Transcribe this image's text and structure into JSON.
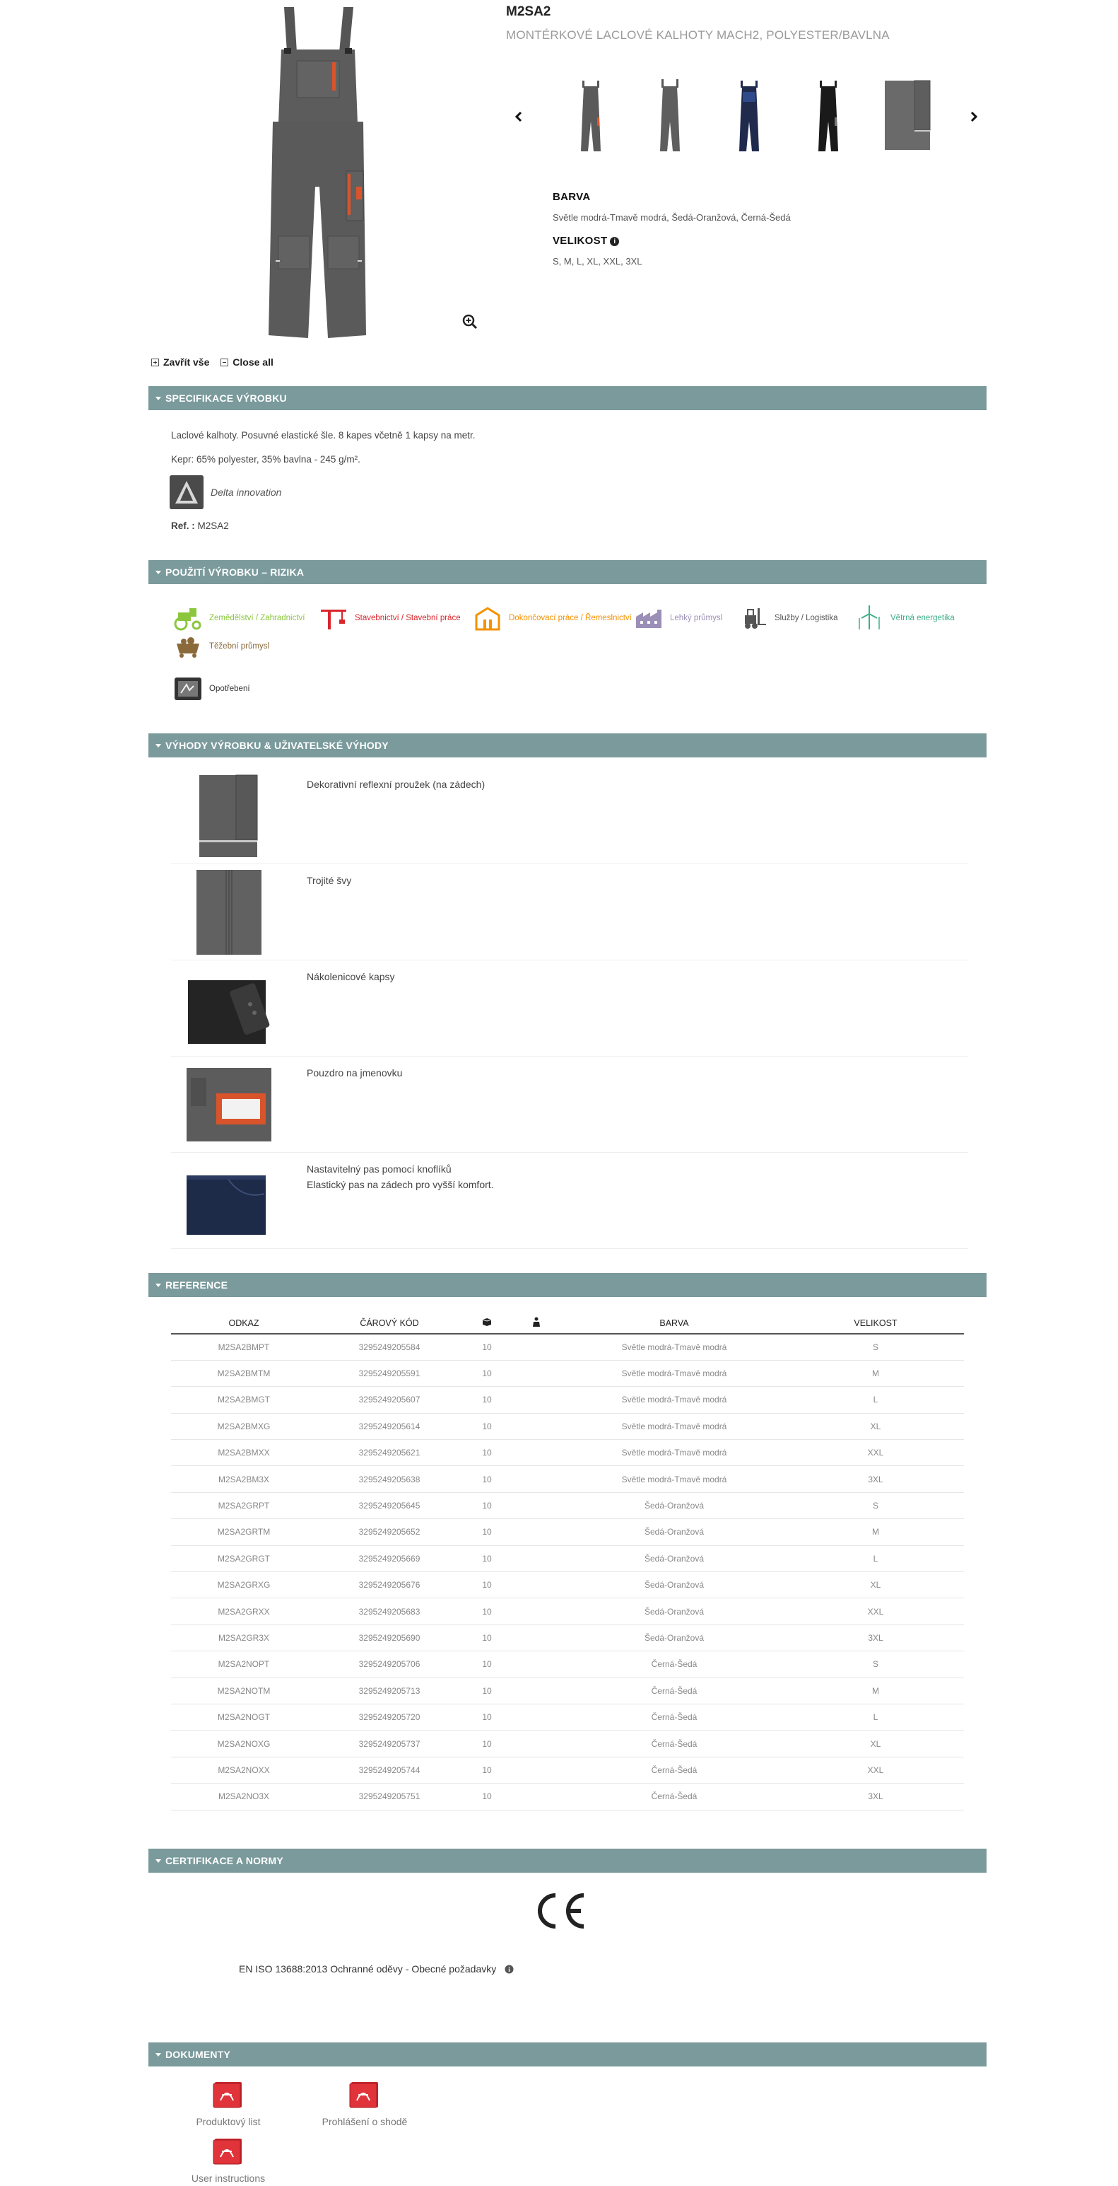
{
  "product": {
    "code": "M2SA2",
    "subtitle": "MONTÉRKOVÉ LACLOVÉ KALHOTY MACH2, POLYESTER/BAVLNA"
  },
  "attributes": {
    "color_heading": "BARVA",
    "color_value": "Světle modrá-Tmavě modrá, Šedá-Oranžová, Černá-Šedá",
    "size_heading": "VELIKOST",
    "size_value": "S, M, L, XL, XXL, 3XL"
  },
  "collapse": {
    "close_all_cz": "Zavřít vše",
    "close_all_en": "Close all"
  },
  "spec": {
    "title": "SPECIFIKACE VÝROBKU",
    "desc": "Laclové kalhoty. Posuvné elastické šle. 8 kapes včetně 1 kapsy na metr.",
    "material": "Kepr: 65% polyester, 35% bavlna - 245 g/m².",
    "innovation": "Delta innovation",
    "ref_label": "Ref. :",
    "ref_value": "M2SA2"
  },
  "usage": {
    "title": "POUŽITÍ VÝROBKU – RIZIKA",
    "items": [
      {
        "label": "Zemědělství / Zahradnictví",
        "color": "#8cc63f"
      },
      {
        "label": "Stavebnictví / Stavební práce",
        "color": "#d9262c"
      },
      {
        "label": "Dokončovací práce / Řemeslnictví",
        "color": "#f39200"
      },
      {
        "label": "Lehký průmysl",
        "color": "#9b8fb7"
      },
      {
        "label": "Služby / Logistika",
        "color": "#555555"
      },
      {
        "label": "Větrná energetika",
        "color": "#3fae8a"
      },
      {
        "label": "Těžební průmysl",
        "color": "#8a6a3a"
      },
      {
        "label": "Opotřebení",
        "color": "#333333"
      }
    ]
  },
  "benefits": {
    "title": "VÝHODY VÝROBKU & UŽIVATELSKÉ VÝHODY",
    "items": [
      {
        "line1": "Dekorativní reflexní proužek (na zádech)",
        "line2": ""
      },
      {
        "line1": "Trojité švy",
        "line2": ""
      },
      {
        "line1": "Nákolenicové kapsy",
        "line2": ""
      },
      {
        "line1": "Pouzdro na jmenovku",
        "line2": ""
      },
      {
        "line1": "Nastavitelný pas pomocí knoflíků",
        "line2": "Elastický pas na zádech pro vyšší komfort."
      }
    ]
  },
  "reference": {
    "title": "REFERENCE",
    "headers": {
      "odkaz": "ODKAZ",
      "kod": "ČÁROVÝ KÓD",
      "barva": "BARVA",
      "velikost": "VELIKOST"
    },
    "rows": [
      [
        "M2SA2BMPT",
        "3295249205584",
        "10",
        "Světle modrá-Tmavě modrá",
        "S"
      ],
      [
        "M2SA2BMTM",
        "3295249205591",
        "10",
        "Světle modrá-Tmavě modrá",
        "M"
      ],
      [
        "M2SA2BMGT",
        "3295249205607",
        "10",
        "Světle modrá-Tmavě modrá",
        "L"
      ],
      [
        "M2SA2BMXG",
        "3295249205614",
        "10",
        "Světle modrá-Tmavě modrá",
        "XL"
      ],
      [
        "M2SA2BMXX",
        "3295249205621",
        "10",
        "Světle modrá-Tmavě modrá",
        "XXL"
      ],
      [
        "M2SA2BM3X",
        "3295249205638",
        "10",
        "Světle modrá-Tmavě modrá",
        "3XL"
      ],
      [
        "M2SA2GRPT",
        "3295249205645",
        "10",
        "Šedá-Oranžová",
        "S"
      ],
      [
        "M2SA2GRTM",
        "3295249205652",
        "10",
        "Šedá-Oranžová",
        "M"
      ],
      [
        "M2SA2GRGT",
        "3295249205669",
        "10",
        "Šedá-Oranžová",
        "L"
      ],
      [
        "M2SA2GRXG",
        "3295249205676",
        "10",
        "Šedá-Oranžová",
        "XL"
      ],
      [
        "M2SA2GRXX",
        "3295249205683",
        "10",
        "Šedá-Oranžová",
        "XXL"
      ],
      [
        "M2SA2GR3X",
        "3295249205690",
        "10",
        "Šedá-Oranžová",
        "3XL"
      ],
      [
        "M2SA2NOPT",
        "3295249205706",
        "10",
        "Černá-Šedá",
        "S"
      ],
      [
        "M2SA2NOTM",
        "3295249205713",
        "10",
        "Černá-Šedá",
        "M"
      ],
      [
        "M2SA2NOGT",
        "3295249205720",
        "10",
        "Černá-Šedá",
        "L"
      ],
      [
        "M2SA2NOXG",
        "3295249205737",
        "10",
        "Černá-Šedá",
        "XL"
      ],
      [
        "M2SA2NOXX",
        "3295249205744",
        "10",
        "Černá-Šedá",
        "XXL"
      ],
      [
        "M2SA2NO3X",
        "3295249205751",
        "10",
        "Černá-Šedá",
        "3XL"
      ]
    ]
  },
  "certification": {
    "title": "CERTIFIKACE A NORMY",
    "mark": "CE",
    "norm": "EN ISO 13688:2013 Ochranné oděvy - Obecné požadavky"
  },
  "documents": {
    "title": "DOKUMENTY",
    "items": [
      "Produktový list",
      "Prohlášení o shodě",
      "User instructions"
    ]
  },
  "colors": {
    "section_bar": "#7a9a9c",
    "accent_orange": "#d9542b"
  }
}
